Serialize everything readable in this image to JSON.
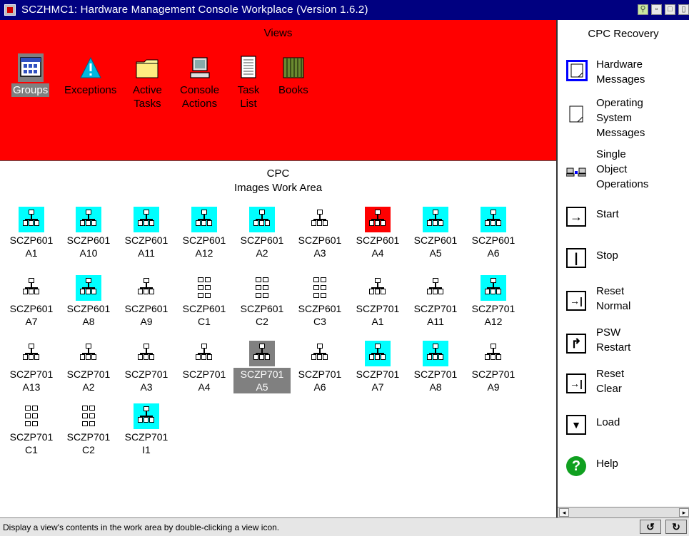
{
  "window": {
    "title": "SCZHMC1: Hardware Management Console Workplace (Version 1.6.2)"
  },
  "views": {
    "header": "Views",
    "items": [
      {
        "label": "Groups",
        "icon": "groups-icon"
      },
      {
        "label": "Exceptions",
        "icon": "exceptions-icon"
      },
      {
        "label": "Active\nTasks",
        "icon": "active-tasks-icon"
      },
      {
        "label": "Console\nActions",
        "icon": "console-actions-icon"
      },
      {
        "label": "Task\nList",
        "icon": "task-list-icon"
      },
      {
        "label": "Books",
        "icon": "books-icon"
      }
    ]
  },
  "work_area": {
    "title": "CPC\nImages Work Area",
    "objects": [
      {
        "name": "SCZP601\nA1",
        "style": "cyan",
        "type": "tree"
      },
      {
        "name": "SCZP601\nA10",
        "style": "cyan",
        "type": "tree"
      },
      {
        "name": "SCZP601\nA11",
        "style": "cyan",
        "type": "tree"
      },
      {
        "name": "SCZP601\nA12",
        "style": "cyan",
        "type": "tree"
      },
      {
        "name": "SCZP601\nA2",
        "style": "cyan",
        "type": "tree"
      },
      {
        "name": "SCZP601\nA3",
        "style": "plain",
        "type": "tree"
      },
      {
        "name": "SCZP601\nA4",
        "style": "red",
        "type": "tree"
      },
      {
        "name": "SCZP601\nA5",
        "style": "cyan",
        "type": "tree"
      },
      {
        "name": "SCZP601\nA6",
        "style": "cyan",
        "type": "tree"
      },
      {
        "name": "SCZP601\nA7",
        "style": "plain",
        "type": "tree"
      },
      {
        "name": "SCZP601\nA8",
        "style": "cyan",
        "type": "tree"
      },
      {
        "name": "SCZP601\nA9",
        "style": "plain",
        "type": "tree"
      },
      {
        "name": "SCZP601\nC1",
        "style": "plain",
        "type": "grid"
      },
      {
        "name": "SCZP601\nC2",
        "style": "plain",
        "type": "grid"
      },
      {
        "name": "SCZP601\nC3",
        "style": "plain",
        "type": "grid"
      },
      {
        "name": "SCZP701\nA1",
        "style": "plain",
        "type": "tree"
      },
      {
        "name": "SCZP701\nA11",
        "style": "plain",
        "type": "tree"
      },
      {
        "name": "SCZP701\nA12",
        "style": "cyan",
        "type": "tree"
      },
      {
        "name": "SCZP701\nA13",
        "style": "plain",
        "type": "tree"
      },
      {
        "name": "SCZP701\nA2",
        "style": "plain",
        "type": "tree"
      },
      {
        "name": "SCZP701\nA3",
        "style": "plain",
        "type": "tree"
      },
      {
        "name": "SCZP701\nA4",
        "style": "plain",
        "type": "tree"
      },
      {
        "name": "SCZP701\nA5",
        "style": "gray",
        "type": "tree",
        "selected": true
      },
      {
        "name": "SCZP701\nA6",
        "style": "plain",
        "type": "tree"
      },
      {
        "name": "SCZP701\nA7",
        "style": "cyan",
        "type": "tree"
      },
      {
        "name": "SCZP701\nA8",
        "style": "cyan",
        "type": "tree"
      },
      {
        "name": "SCZP701\nA9",
        "style": "plain",
        "type": "tree"
      },
      {
        "name": "SCZP701\nC1",
        "style": "plain",
        "type": "grid"
      },
      {
        "name": "SCZP701\nC2",
        "style": "plain",
        "type": "grid"
      },
      {
        "name": "SCZP701\nI1",
        "style": "cyan",
        "type": "tree"
      }
    ]
  },
  "tasks": {
    "title": "CPC Recovery",
    "items": [
      {
        "label": "Hardware\nMessages",
        "icon": "hardware-messages-icon"
      },
      {
        "label": "Operating\nSystem\nMessages",
        "icon": "os-messages-icon"
      },
      {
        "label": "Single\nObject\nOperations",
        "icon": "single-object-operations-icon"
      },
      {
        "label": "Start",
        "icon": "start-icon",
        "glyph": "→"
      },
      {
        "label": "Stop",
        "icon": "stop-icon",
        "glyph": "|"
      },
      {
        "label": "Reset\nNormal",
        "icon": "reset-normal-icon",
        "glyph": "→|"
      },
      {
        "label": "PSW\nRestart",
        "icon": "psw-restart-icon",
        "glyph": "↱"
      },
      {
        "label": "Reset\nClear",
        "icon": "reset-clear-icon",
        "glyph": "→|"
      },
      {
        "label": "Load",
        "icon": "load-icon",
        "glyph": "▼"
      },
      {
        "label": "Help",
        "icon": "help-icon",
        "glyph": "?"
      }
    ]
  },
  "status": {
    "message": "Display a view's contents in the work area by double-clicking a view icon."
  },
  "colors": {
    "title_bar": "#000080",
    "views_bg": "#ff0000",
    "highlight": "#00ffff",
    "alert": "#ff0000",
    "selected": "#808080"
  }
}
